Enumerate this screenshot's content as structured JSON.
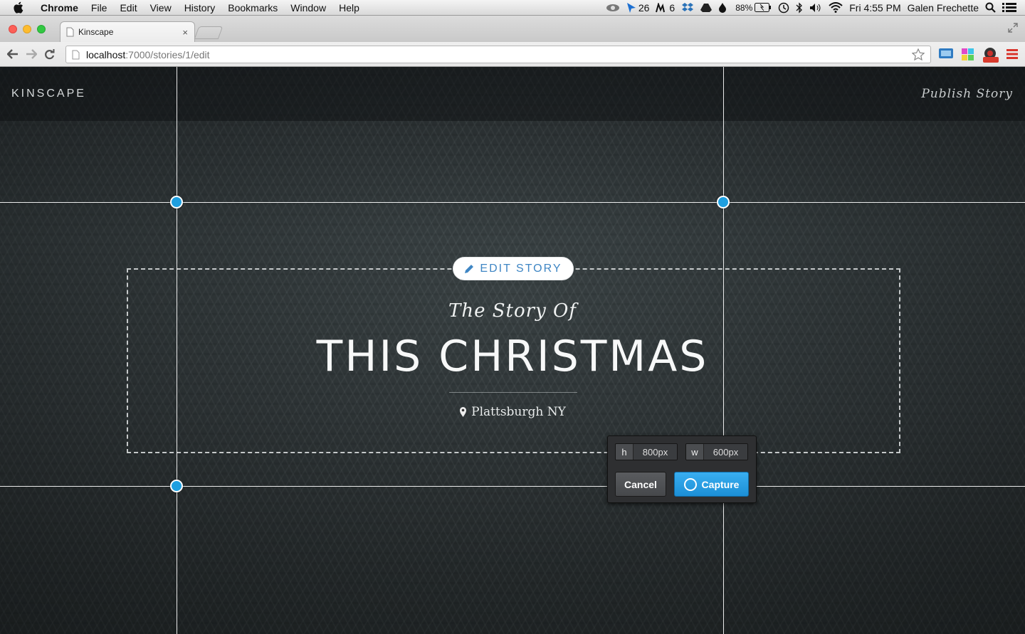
{
  "menubar": {
    "app": "Chrome",
    "items": [
      "File",
      "Edit",
      "View",
      "History",
      "Bookmarks",
      "Window",
      "Help"
    ],
    "status": {
      "counter_a": "26",
      "counter_b": "6",
      "battery": "88%",
      "clock": "Fri 4:55 PM",
      "user": "Galen Frechette"
    }
  },
  "browser": {
    "tab_title": "Kinscape",
    "tab_close": "×",
    "url_host": "localhost",
    "url_path": ":7000/stories/1/edit"
  },
  "site": {
    "logo": "KINSCAPE",
    "publish_label": "Publish Story"
  },
  "story": {
    "edit_label": "EDIT STORY",
    "pretitle": "The Story Of",
    "title": "THIS CHRISTMAS",
    "location": "Plattsburgh NY"
  },
  "capture": {
    "h_label": "h",
    "h_value": "800px",
    "w_label": "w",
    "w_value": "600px",
    "cancel_label": "Cancel",
    "capture_label": "Capture"
  },
  "colors": {
    "accent_blue": "#1e9fe0",
    "edit_text": "#3f86c4"
  }
}
